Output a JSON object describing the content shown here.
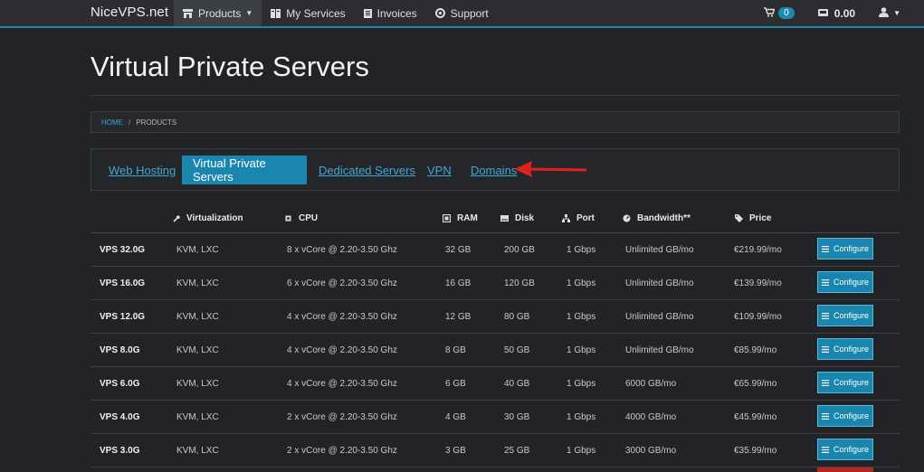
{
  "navbar": {
    "brand": "NiceVPS.net",
    "items": [
      {
        "label": "Products",
        "icon": "store-icon",
        "active": true
      },
      {
        "label": "My Services",
        "icon": "services-icon"
      },
      {
        "label": "Invoices",
        "icon": "invoice-icon"
      },
      {
        "label": "Support",
        "icon": "lifebuoy-icon"
      }
    ],
    "cart_count": "0",
    "credit": "0.00",
    "accent": "#1d86a6"
  },
  "page": {
    "title": "Virtual Private Servers"
  },
  "breadcrumb": {
    "home": "HOME",
    "separator": "/",
    "current": "PRODUCTS"
  },
  "tabs": [
    {
      "label": "Web Hosting",
      "active": false
    },
    {
      "label": "Virtual Private Servers",
      "active": true
    },
    {
      "label": "Dedicated Servers",
      "active": false
    },
    {
      "label": "VPN",
      "active": false
    },
    {
      "label": "Domains",
      "active": false
    }
  ],
  "annotation": {
    "color": "#e02020",
    "points_to": "Domains"
  },
  "table": {
    "headers": {
      "virtualization": "Virtualization",
      "cpu": "CPU",
      "ram": "RAM",
      "disk": "Disk",
      "port": "Port",
      "bandwidth": "Bandwidth**",
      "price": "Price"
    },
    "button_label": "Configure",
    "rows": [
      {
        "name": "VPS 32.0G",
        "virt": "KVM, LXC",
        "cpu": "8 x vCore @ 2.20-3.50 Ghz",
        "ram": "32 GB",
        "disk": "200 GB",
        "port": "1 Gbps",
        "bw": "Unlimited GB/mo",
        "price": "€219.99/mo"
      },
      {
        "name": "VPS 16.0G",
        "virt": "KVM, LXC",
        "cpu": "6 x vCore @ 2.20-3.50 Ghz",
        "ram": "16 GB",
        "disk": "120 GB",
        "port": "1 Gbps",
        "bw": "Unlimited GB/mo",
        "price": "€139.99/mo"
      },
      {
        "name": "VPS 12.0G",
        "virt": "KVM, LXC",
        "cpu": "4 x vCore @ 2.20-3.50 Ghz",
        "ram": "12 GB",
        "disk": "80 GB",
        "port": "1 Gbps",
        "bw": "Unlimited GB/mo",
        "price": "€109.99/mo"
      },
      {
        "name": "VPS 8.0G",
        "virt": "KVM, LXC",
        "cpu": "4 x vCore @ 2.20-3.50 Ghz",
        "ram": "8 GB",
        "disk": "50 GB",
        "port": "1 Gbps",
        "bw": "Unlimited GB/mo",
        "price": "€85.99/mo"
      },
      {
        "name": "VPS 6.0G",
        "virt": "KVM, LXC",
        "cpu": "4 x vCore @ 2.20-3.50 Ghz",
        "ram": "6 GB",
        "disk": "40 GB",
        "port": "1 Gbps",
        "bw": "6000 GB/mo",
        "price": "€65.99/mo"
      },
      {
        "name": "VPS 4.0G",
        "virt": "KVM, LXC",
        "cpu": "2 x vCore @ 2.20-3.50 Ghz",
        "ram": "4 GB",
        "disk": "30 GB",
        "port": "1 Gbps",
        "bw": "4000 GB/mo",
        "price": "€45.99/mo"
      },
      {
        "name": "VPS 3.0G",
        "virt": "KVM, LXC",
        "cpu": "2 x vCore @ 2.20-3.50 Ghz",
        "ram": "3 GB",
        "disk": "25 GB",
        "port": "1 Gbps",
        "bw": "3000 GB/mo",
        "price": "€35.99/mo"
      }
    ]
  }
}
